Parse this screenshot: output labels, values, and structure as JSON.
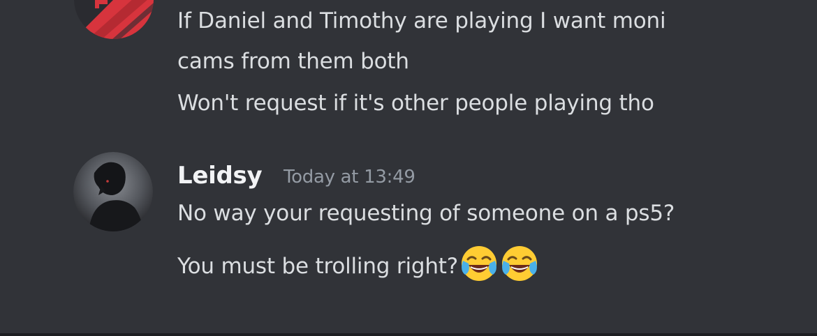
{
  "messages": [
    {
      "avatar_icon": "team-logo-avatar",
      "lines": [
        "If Daniel and Timothy are playing I want moni",
        "cams from them both",
        "Won't request if it's other people playing tho"
      ]
    },
    {
      "avatar_icon": "user-avatar",
      "username": "Leidsy",
      "timestamp": "Today at 13:49",
      "lines": [
        "No way your requesting of someone on a ps5?",
        "You must be trolling right?"
      ],
      "emojis": [
        "face-with-tears-of-joy-icon",
        "face-with-tears-of-joy-icon"
      ]
    }
  ],
  "colors": {
    "background": "#313338",
    "text": "#dbdee1",
    "username": "#f2f3f5",
    "timestamp": "#949ba4",
    "avatar_red": "#d7343d"
  }
}
